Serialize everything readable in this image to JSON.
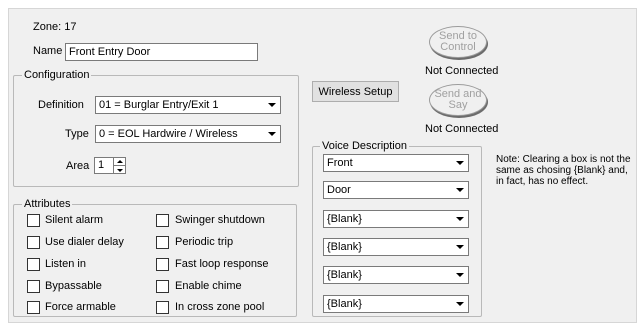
{
  "zone": {
    "label": "Zone:",
    "number": "17"
  },
  "name": {
    "label": "Name",
    "value": "Front Entry Door"
  },
  "configuration": {
    "title": "Configuration",
    "definition": {
      "label": "Definition",
      "value": "01 = Burglar Entry/Exit 1"
    },
    "type": {
      "label": "Type",
      "value": "0 = EOL Hardwire / Wireless"
    },
    "area": {
      "label": "Area",
      "value": "1"
    }
  },
  "attributes": {
    "title": "Attributes",
    "left": [
      "Silent alarm",
      "Use dialer delay",
      "Listen in",
      "Bypassable",
      "Force armable"
    ],
    "right": [
      "Swinger shutdown",
      "Periodic trip",
      "Fast loop response",
      "Enable chime",
      "In cross zone pool"
    ]
  },
  "buttons": {
    "send_control": "Send to Control",
    "send_control_status": "Not Connected",
    "send_say": "Send and Say",
    "send_say_status": "Not Connected",
    "wireless_setup": "Wireless Setup"
  },
  "voice": {
    "title": "Voice Description",
    "values": [
      "Front",
      "Door",
      "{Blank}",
      "{Blank}",
      "{Blank}",
      "{Blank}"
    ]
  },
  "note": "Note: Clearing a box is not the same as chosing {Blank} and, in fact, has no effect."
}
